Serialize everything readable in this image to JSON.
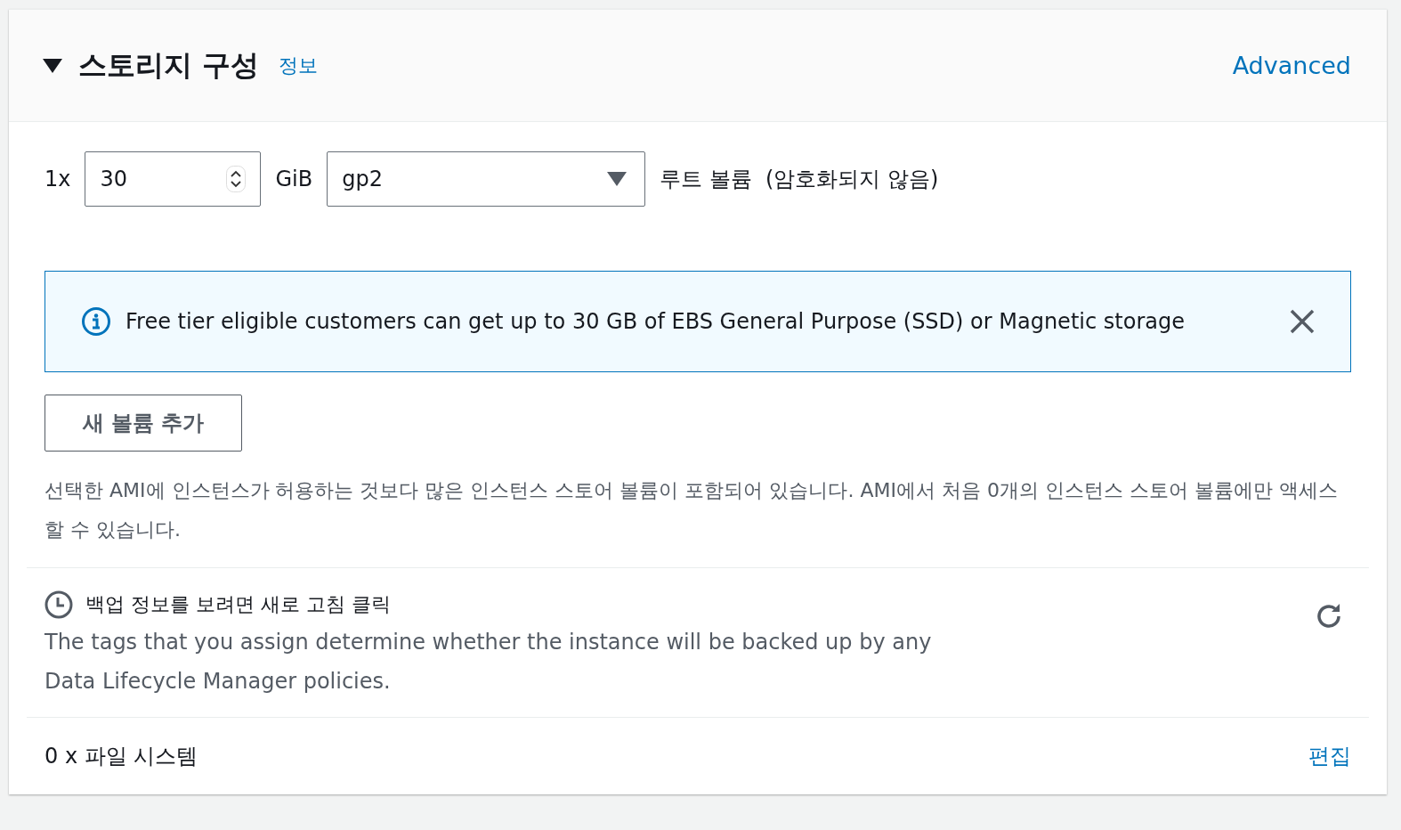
{
  "section": {
    "title": "스토리지 구성",
    "info_link": "정보",
    "expanded": true,
    "advanced_link": "Advanced"
  },
  "volume": {
    "count": "1x",
    "size": "30",
    "unit": "GiB",
    "type": "gp2",
    "description": "루트 볼륨  (암호화되지 않음)"
  },
  "alert": {
    "message": "Free tier eligible customers can get up to 30 GB of EBS General Purpose (SSD) or Magnetic storage",
    "dismissible": true
  },
  "add_volume_button": "새 볼륨 추가",
  "store_notice": "선택한 AMI에 인스턴스가 허용하는 것보다 많은 인스턴스 스토어 볼륨이 포함되어 있습니다. AMI에서 처음 0개의 인스턴스 스토어 볼륨에만 액세스할 수 있습니다.",
  "backup": {
    "title": "백업 정보를 보려면 새로 고침 클릭",
    "description": "The tags that you assign determine whether the instance will be backed up by any Data Lifecycle Manager policies."
  },
  "file_systems": {
    "label": "0 x 파일 시스템",
    "edit_link": "편집"
  }
}
